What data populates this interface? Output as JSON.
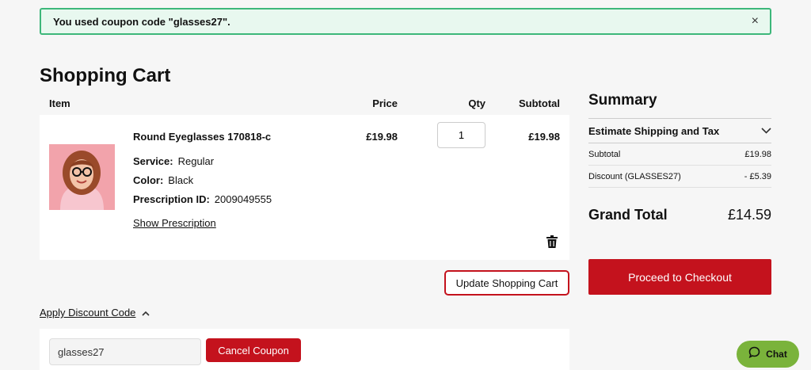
{
  "notice": {
    "text": "You used coupon code \"glasses27\".",
    "close": "×"
  },
  "page": {
    "title": "Shopping Cart"
  },
  "cart_table": {
    "headers": {
      "item": "Item",
      "price": "Price",
      "qty": "Qty",
      "subtotal": "Subtotal"
    },
    "rows": [
      {
        "name": "Round Eyeglasses 170818-c",
        "attributes": [
          {
            "label": "Service:",
            "value": "Regular"
          },
          {
            "label": "Color:",
            "value": "Black"
          },
          {
            "label": "Prescription ID:",
            "value": "2009049555"
          }
        ],
        "show_prescription": "Show Prescription",
        "price": "£19.98",
        "qty": "1",
        "subtotal": "£19.98",
        "icons": {
          "thumbnail": "product-photo-icon",
          "remove": "trash-icon"
        }
      }
    ]
  },
  "actions": {
    "update_cart": "Update Shopping Cart"
  },
  "discount": {
    "toggle_label": "Apply Discount Code",
    "code_value": "glasses27",
    "cancel_label": "Cancel Coupon",
    "toggle_icon": "chevron-up-icon"
  },
  "summary": {
    "title": "Summary",
    "shipping_label": "Estimate Shipping and Tax",
    "shipping_icon": "chevron-down-icon",
    "lines": [
      {
        "label": "Subtotal",
        "value": "£19.98"
      },
      {
        "label": "Discount (GLASSES27)",
        "value": "- £5.39"
      }
    ],
    "grand_total_label": "Grand Total",
    "grand_total_value": "£14.59",
    "checkout_label": "Proceed to Checkout"
  },
  "chat": {
    "label": "Chat",
    "icon": "chat-bubble-icon"
  },
  "colors": {
    "brand_red": "#c4121d",
    "success_border": "#3db77a",
    "success_bg": "#e8f8ef",
    "chat_green": "#7ab33b"
  }
}
